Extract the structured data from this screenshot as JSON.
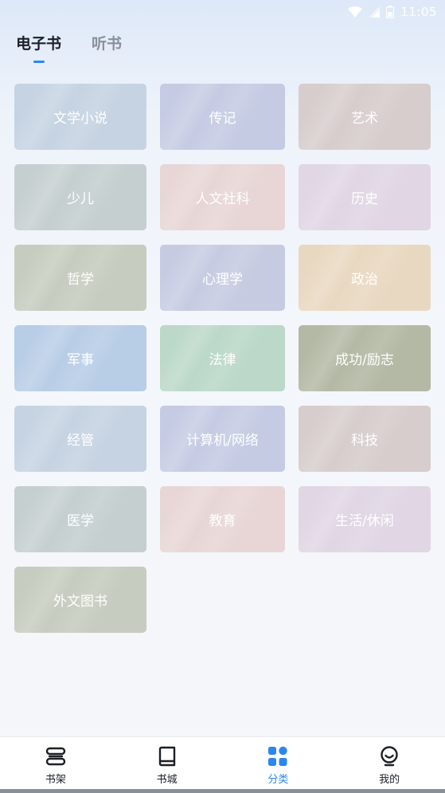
{
  "status_bar": {
    "time": "11:05",
    "icons": [
      "wifi-icon",
      "signal-icon",
      "battery-icon"
    ]
  },
  "tabs": [
    {
      "label": "电子书",
      "active": true
    },
    {
      "label": "听书",
      "active": false
    }
  ],
  "categories": [
    {
      "label": "文学小说",
      "color": "#c5d3e2"
    },
    {
      "label": "传记",
      "color": "#c5cbe3"
    },
    {
      "label": "艺术",
      "color": "#d6cdcc"
    },
    {
      "label": "少儿",
      "color": "#c5cfd0"
    },
    {
      "label": "人文社科",
      "color": "#e8d6d6"
    },
    {
      "label": "历史",
      "color": "#e0d6e4"
    },
    {
      "label": "哲学",
      "color": "#c6ccbf"
    },
    {
      "label": "心理学",
      "color": "#c7cbe2"
    },
    {
      "label": "政治",
      "color": "#e9d8c1"
    },
    {
      "label": "军事",
      "color": "#b8cde6"
    },
    {
      "label": "法律",
      "color": "#bbd8c8"
    },
    {
      "label": "成功/励志",
      "color": "#b3b9a4"
    },
    {
      "label": "经管",
      "color": "#c5d3e2"
    },
    {
      "label": "计算机/网络",
      "color": "#c5cbe3"
    },
    {
      "label": "科技",
      "color": "#d6cdcc"
    },
    {
      "label": "医学",
      "color": "#c5cfd0"
    },
    {
      "label": "教育",
      "color": "#e8d6d6"
    },
    {
      "label": "生活/休闲",
      "color": "#e0d6e4"
    },
    {
      "label": "外文图书",
      "color": "#c6ccbf"
    }
  ],
  "bottom_nav": [
    {
      "label": "书架",
      "icon": "bookshelf-icon",
      "active": false
    },
    {
      "label": "书城",
      "icon": "book-icon",
      "active": false
    },
    {
      "label": "分类",
      "icon": "grid-icon",
      "active": true
    },
    {
      "label": "我的",
      "icon": "profile-icon",
      "active": false
    }
  ],
  "accent_color": "#2b86f0"
}
